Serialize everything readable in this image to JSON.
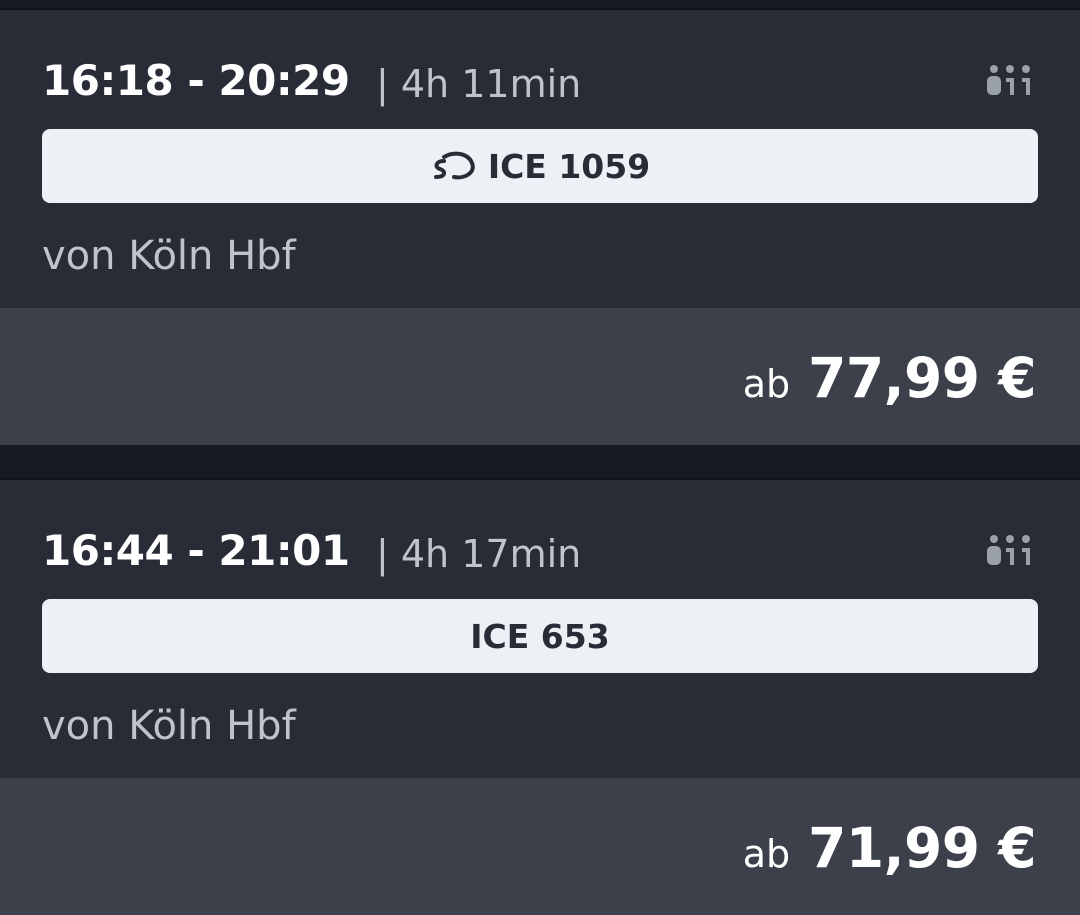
{
  "connections": [
    {
      "times": "16:18 - 20:29",
      "duration": "| 4h 11min",
      "occupancy_icon": "occupancy-people-icon",
      "train": "ICE 1059",
      "has_sprinter_icon": true,
      "from": "von Köln Hbf",
      "price_prefix": "ab",
      "price": "77,99 €"
    },
    {
      "times": "16:44 - 21:01",
      "duration": "| 4h 17min",
      "occupancy_icon": "occupancy-people-icon",
      "train": "ICE 653",
      "has_sprinter_icon": false,
      "from": "von Köln Hbf",
      "price_prefix": "ab",
      "price": "71,99 €"
    }
  ],
  "colors": {
    "card_background": "#282c37",
    "price_background": "#3c404b",
    "page_background": "#161a22",
    "train_bar": "#edf0f4"
  }
}
